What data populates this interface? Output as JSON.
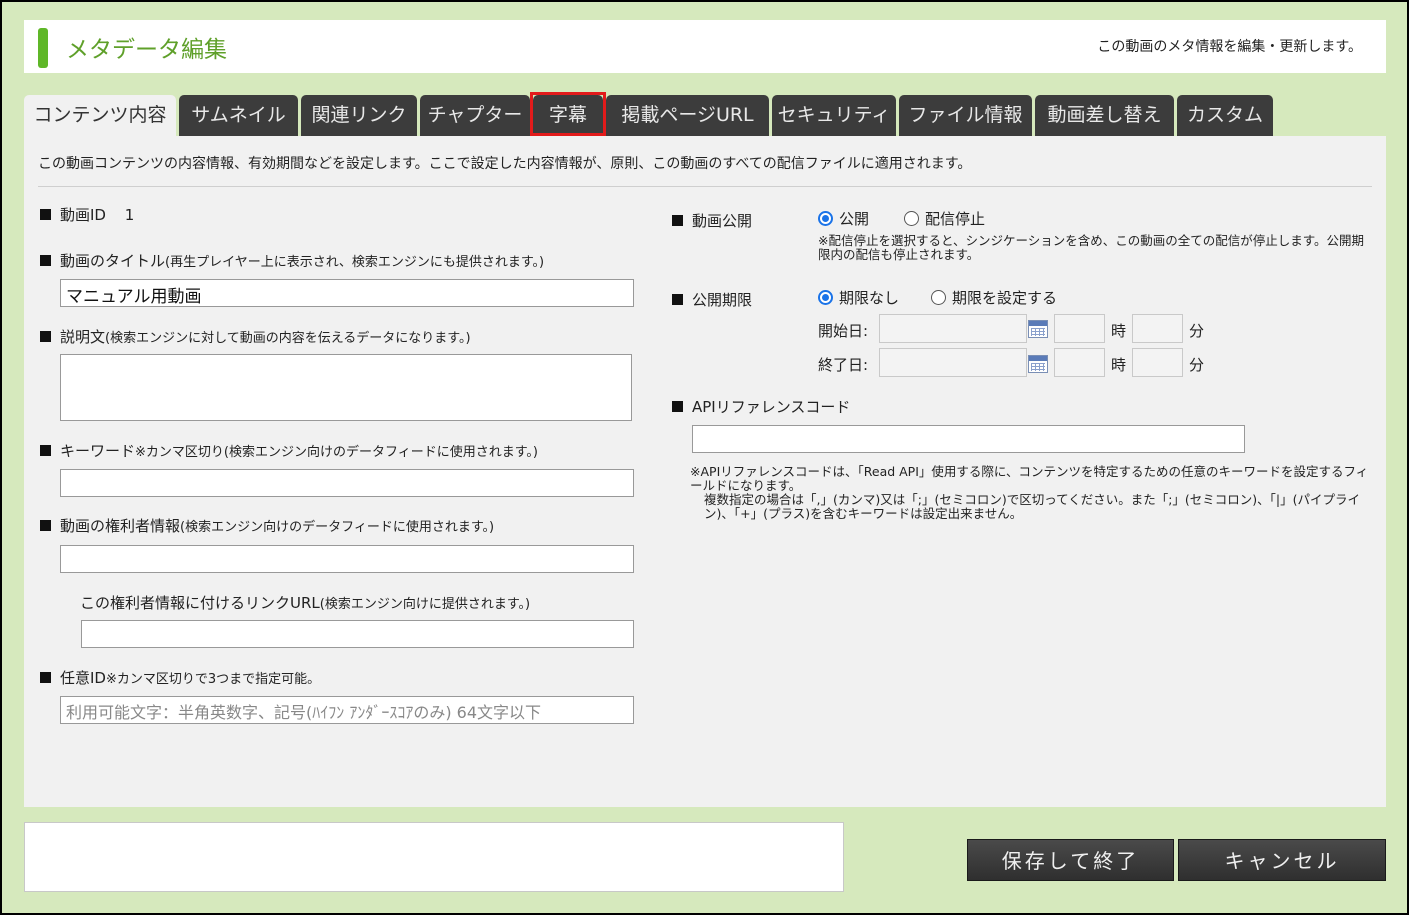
{
  "header": {
    "title": "メタデータ編集",
    "description": "この動画のメタ情報を編集・更新します。"
  },
  "tabs": [
    {
      "label": "コンテンツ内容",
      "active": true
    },
    {
      "label": "サムネイル"
    },
    {
      "label": "関連リンク"
    },
    {
      "label": "チャプター"
    },
    {
      "label": "字幕",
      "highlighted": true
    },
    {
      "label": "掲載ページURL"
    },
    {
      "label": "セキュリティ"
    },
    {
      "label": "ファイル情報"
    },
    {
      "label": "動画差し替え"
    },
    {
      "label": "カスタム"
    }
  ],
  "intro": "この動画コンテンツの内容情報、有効期間などを設定します。ここで設定した内容情報が、原則、この動画のすべての配信ファイルに適用されます。",
  "left": {
    "video_id_label": "動画ID",
    "video_id_value": "1",
    "title_label": "動画のタイトル",
    "title_sub": "(再生プレイヤー上に表示され、検索エンジンにも提供されます。)",
    "title_value": "マニュアル用動画",
    "description_label": "説明文",
    "description_sub": "(検索エンジンに対して動画の内容を伝えるデータになります。)",
    "description_value": "",
    "keywords_label": "キーワード",
    "keywords_sub": "※カンマ区切り(検索エンジン向けのデータフィードに使用されます。)",
    "keywords_value": "",
    "rights_label": "動画の権利者情報",
    "rights_sub": "(検索エンジン向けのデータフィードに使用されます。)",
    "rights_value": "",
    "rights_link_label": "この権利者情報に付けるリンクURL",
    "rights_link_sub": "(検索エンジン向けに提供されます。)",
    "rights_link_value": "",
    "custom_id_label": "任意ID",
    "custom_id_sub": "※カンマ区切りで3つまで指定可能。",
    "custom_id_placeholder": "利用可能文字：半角英数字、記号(ﾊｲﾌﾝ ｱﾝﾀﾞｰｽｺｱのみ) 64文字以下"
  },
  "right": {
    "publish_label": "動画公開",
    "publish_options": [
      "公開",
      "配信停止"
    ],
    "publish_selected": "公開",
    "publish_note": "※配信停止を選択すると、シンジケーションを含め、この動画の全ての配信が停止します。公開期限内の配信も停止されます。",
    "period_label": "公開期限",
    "period_options": [
      "期限なし",
      "期限を設定する"
    ],
    "period_selected": "期限なし",
    "start_label": "開始日:",
    "end_label": "終了日:",
    "hour_label": "時",
    "minute_label": "分",
    "api_label": "APIリファレンスコード",
    "api_value": "",
    "api_note_1": "※APIリファレンスコードは、「Read API」使用する際に、コンテンツを特定するための任意のキーワードを設定するフィールドになります。",
    "api_note_2": "複数指定の場合は「,」(カンマ)又は「;」(セミコロン)で区切ってください。また「;」(セミコロン)、「|」(パイプライン)、「+」(プラス)を含むキーワードは設定出来ません。"
  },
  "buttons": {
    "save": "保存して終了",
    "cancel": "キャンセル"
  },
  "colors": {
    "accent_green": "#5fb728",
    "background_green": "#d6e9bd",
    "tab_dark": "#3c3c3c",
    "highlight_red": "#e21b1b",
    "radio_blue": "#1a73e8"
  }
}
